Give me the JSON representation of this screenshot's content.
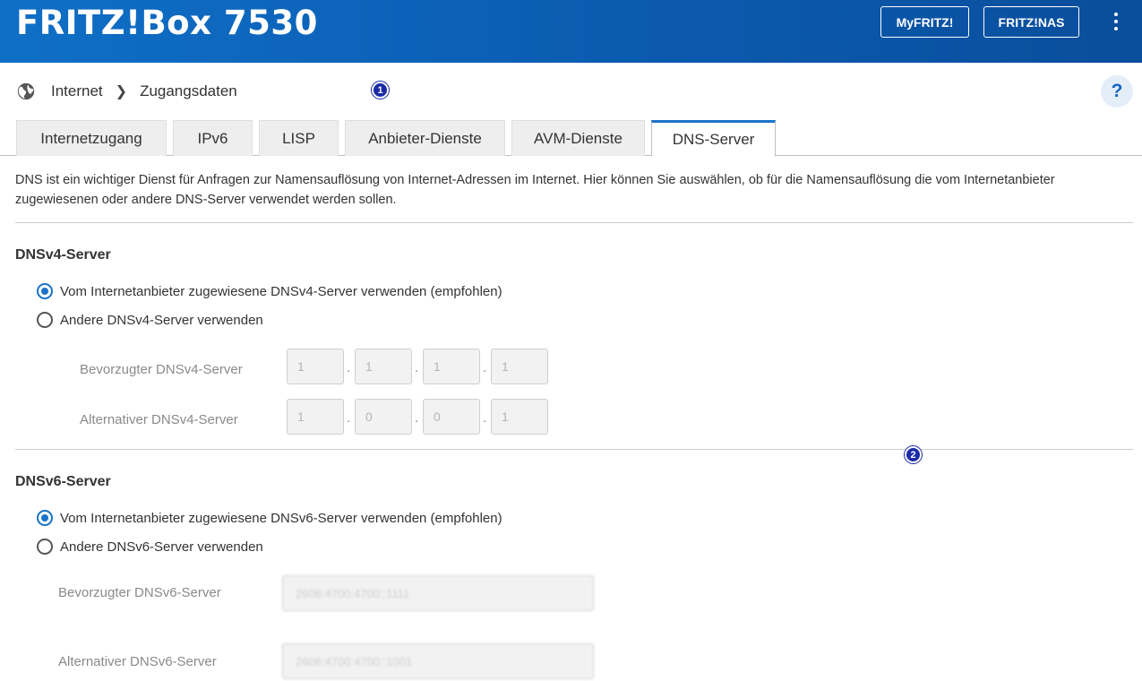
{
  "header": {
    "title": "FRITZ!Box 7530",
    "buttons": {
      "myfritz": "MyFRITZ!",
      "nas": "FRITZ!NAS"
    },
    "menu_icon": "kebab-menu-icon",
    "background": "#0b5bb0"
  },
  "breadcrumb": {
    "icon": "globe-icon",
    "items": [
      "Internet",
      "Zugangsdaten"
    ],
    "separator": ">"
  },
  "help_label": "?",
  "badges": [
    "1",
    "2"
  ],
  "tabs": [
    {
      "label": "Internetzugang",
      "active": false
    },
    {
      "label": "IPv6",
      "active": false
    },
    {
      "label": "LISP",
      "active": false
    },
    {
      "label": "Anbieter-Dienste",
      "active": false
    },
    {
      "label": "AVM-Dienste",
      "active": false
    },
    {
      "label": "DNS-Server",
      "active": true
    }
  ],
  "intro": "DNS ist ein wichtiger Dienst für Anfragen zur Namensauflösung von Internet-Adressen im Internet. Hier können Sie auswählen, ob für die Namensauflösung die vom Internetanbieter zugewiesenen oder andere DNS-Server verwendet werden sollen.",
  "dnsv4": {
    "title": "DNSv4-Server",
    "options": [
      {
        "label": "Vom Internetanbieter zugewiesene DNSv4-Server verwenden (empfohlen)",
        "checked": true
      },
      {
        "label": "Andere DNSv4-Server verwenden",
        "checked": false
      }
    ],
    "preferred": {
      "label": "Bevorzugter DNSv4-Server",
      "octets": [
        "1",
        "1",
        "1",
        "1"
      ]
    },
    "alternative": {
      "label": "Alternativer DNSv4-Server",
      "octets": [
        "1",
        "0",
        "0",
        "1"
      ]
    }
  },
  "dnsv6": {
    "title": "DNSv6-Server",
    "options": [
      {
        "label": "Vom Internetanbieter zugewiesene DNSv6-Server verwenden (empfohlen)",
        "checked": true
      },
      {
        "label": "Andere DNSv6-Server verwenden",
        "checked": false
      }
    ],
    "preferred": {
      "label": "Bevorzugter DNSv6-Server",
      "value": "2606:4700:4700::1111"
    },
    "alternative": {
      "label": "Alternativer DNSv6-Server",
      "value": "2606:4700:4700::1001"
    }
  },
  "colors": {
    "accent": "#1a73c8",
    "badge": "#1a2aa8"
  }
}
